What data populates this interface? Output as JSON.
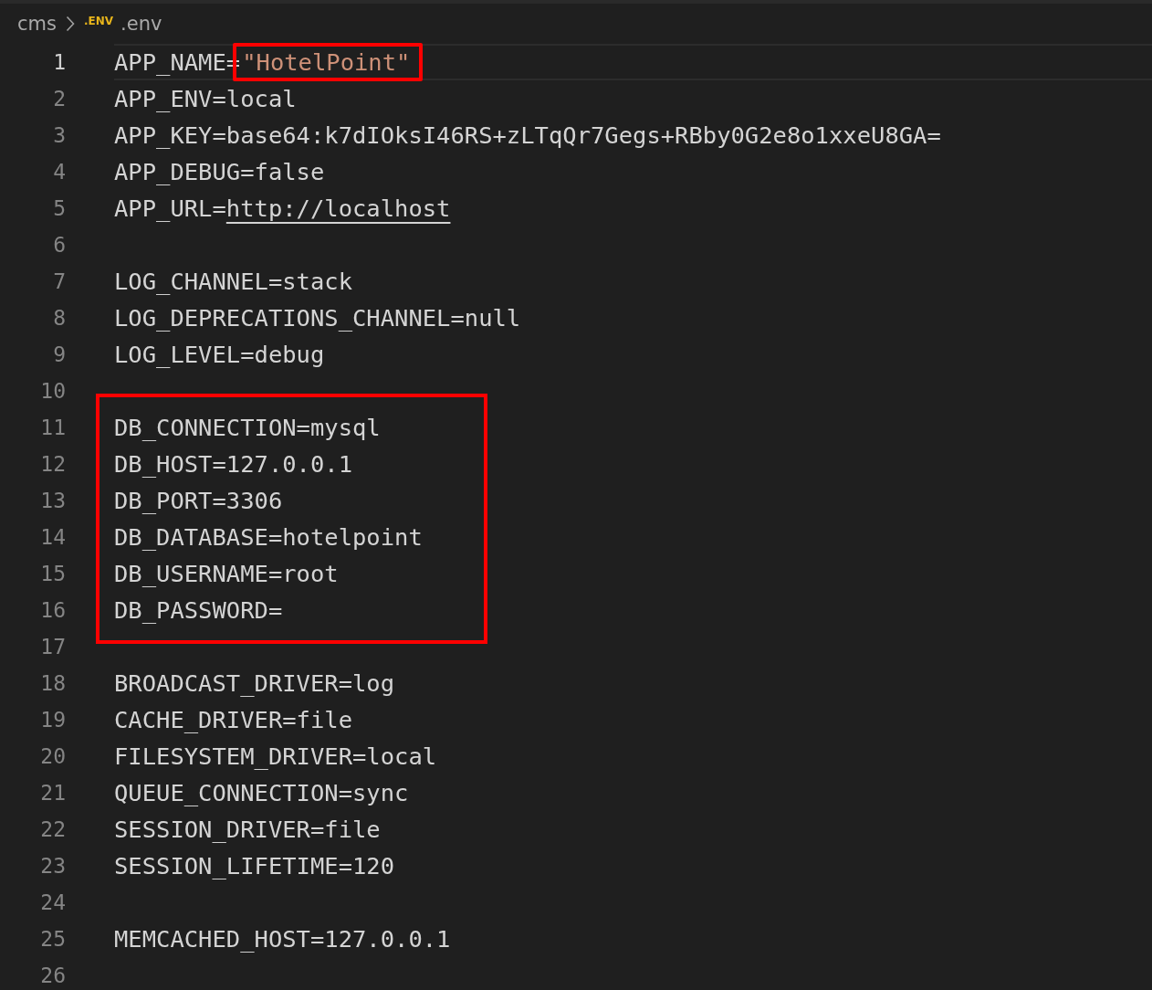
{
  "breadcrumb": {
    "folder": "cms",
    "file_icon_text": ".ENV",
    "file": ".env"
  },
  "groups": [
    {
      "boxed": false,
      "lines": [
        {
          "number": "1",
          "current": true,
          "key": "APP_NAME=",
          "value": "\"HotelPoint\"",
          "kind": "string",
          "value_boxed": true
        },
        {
          "number": "2",
          "current": false,
          "key": "APP_ENV=",
          "value": "local",
          "kind": "plain",
          "value_boxed": false
        },
        {
          "number": "3",
          "current": false,
          "key": "APP_KEY=",
          "value": "base64:k7dIOksI46RS+zLTqQr7Gegs+RBby0G2e8o1xxeU8GA=",
          "kind": "plain",
          "value_boxed": false
        },
        {
          "number": "4",
          "current": false,
          "key": "APP_DEBUG=",
          "value": "false",
          "kind": "plain",
          "value_boxed": false
        },
        {
          "number": "5",
          "current": false,
          "key": "APP_URL=",
          "value": "http://localhost",
          "kind": "link",
          "value_boxed": false
        },
        {
          "number": "6",
          "current": false
        },
        {
          "number": "7",
          "current": false,
          "key": "LOG_CHANNEL=",
          "value": "stack",
          "kind": "plain",
          "value_boxed": false
        },
        {
          "number": "8",
          "current": false,
          "key": "LOG_DEPRECATIONS_CHANNEL=",
          "value": "null",
          "kind": "plain",
          "value_boxed": false
        },
        {
          "number": "9",
          "current": false,
          "key": "LOG_LEVEL=",
          "value": "debug",
          "kind": "plain",
          "value_boxed": false
        },
        {
          "number": "10",
          "current": false
        }
      ]
    },
    {
      "boxed": true,
      "lines": [
        {
          "number": "11",
          "current": false,
          "key": "DB_CONNECTION=",
          "value": "mysql",
          "kind": "plain",
          "value_boxed": false
        },
        {
          "number": "12",
          "current": false,
          "key": "DB_HOST=",
          "value": "127.0.0.1",
          "kind": "plain",
          "value_boxed": false
        },
        {
          "number": "13",
          "current": false,
          "key": "DB_PORT=",
          "value": "3306",
          "kind": "plain",
          "value_boxed": false
        },
        {
          "number": "14",
          "current": false,
          "key": "DB_DATABASE=",
          "value": "hotelpoint",
          "kind": "plain",
          "value_boxed": false
        },
        {
          "number": "15",
          "current": false,
          "key": "DB_USERNAME=",
          "value": "root",
          "kind": "plain",
          "value_boxed": false
        },
        {
          "number": "16",
          "current": false,
          "key": "DB_PASSWORD="
        }
      ]
    },
    {
      "boxed": false,
      "lines": [
        {
          "number": "17",
          "current": false
        },
        {
          "number": "18",
          "current": false,
          "key": "BROADCAST_DRIVER=",
          "value": "log",
          "kind": "plain",
          "value_boxed": false
        },
        {
          "number": "19",
          "current": false,
          "key": "CACHE_DRIVER=",
          "value": "file",
          "kind": "plain",
          "value_boxed": false
        },
        {
          "number": "20",
          "current": false,
          "key": "FILESYSTEM_DRIVER=",
          "value": "local",
          "kind": "plain",
          "value_boxed": false
        },
        {
          "number": "21",
          "current": false,
          "key": "QUEUE_CONNECTION=",
          "value": "sync",
          "kind": "plain",
          "value_boxed": false
        },
        {
          "number": "22",
          "current": false,
          "key": "SESSION_DRIVER=",
          "value": "file",
          "kind": "plain",
          "value_boxed": false
        },
        {
          "number": "23",
          "current": false,
          "key": "SESSION_LIFETIME=",
          "value": "120",
          "kind": "plain",
          "value_boxed": false
        },
        {
          "number": "24",
          "current": false
        },
        {
          "number": "25",
          "current": false,
          "key": "MEMCACHED_HOST=",
          "value": "127.0.0.1",
          "kind": "plain",
          "value_boxed": false
        },
        {
          "number": "26",
          "current": false
        }
      ]
    }
  ]
}
